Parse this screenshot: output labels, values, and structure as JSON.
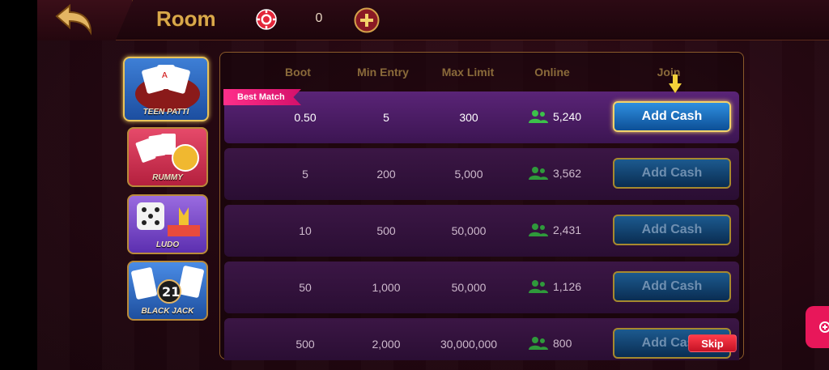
{
  "header": {
    "title": "Room",
    "balance": "0"
  },
  "games": [
    {
      "label": "TEEN PATTI",
      "selected": true
    },
    {
      "label": "RUMMY"
    },
    {
      "label": "LUDO"
    },
    {
      "label": "BLACK JACK"
    }
  ],
  "table": {
    "columns": [
      "Boot",
      "Min Entry",
      "Max Limit",
      "Online",
      "Join"
    ],
    "best_match_label": "Best Match",
    "rows": [
      {
        "boot": "0.50",
        "min_entry": "5",
        "max_limit": "300",
        "online": "5,240",
        "join_label": "Add Cash"
      },
      {
        "boot": "5",
        "min_entry": "200",
        "max_limit": "5,000",
        "online": "3,562",
        "join_label": "Add Cash"
      },
      {
        "boot": "10",
        "min_entry": "500",
        "max_limit": "50,000",
        "online": "2,431",
        "join_label": "Add Cash"
      },
      {
        "boot": "50",
        "min_entry": "1,000",
        "max_limit": "50,000",
        "online": "1,126",
        "join_label": "Add Cash"
      },
      {
        "boot": "500",
        "min_entry": "2,000",
        "max_limit": "30,000,000",
        "online": "800",
        "join_label": "Add Cash"
      }
    ]
  },
  "skip_label": "Skip",
  "colors": {
    "accent_gold": "#d9a84a",
    "best_match_pink": "#ff2f8a",
    "online_green": "#3cc24a"
  },
  "icons": [
    "back-arrow-icon",
    "chip-icon",
    "plus-icon",
    "users-icon",
    "down-arrow-icon"
  ]
}
